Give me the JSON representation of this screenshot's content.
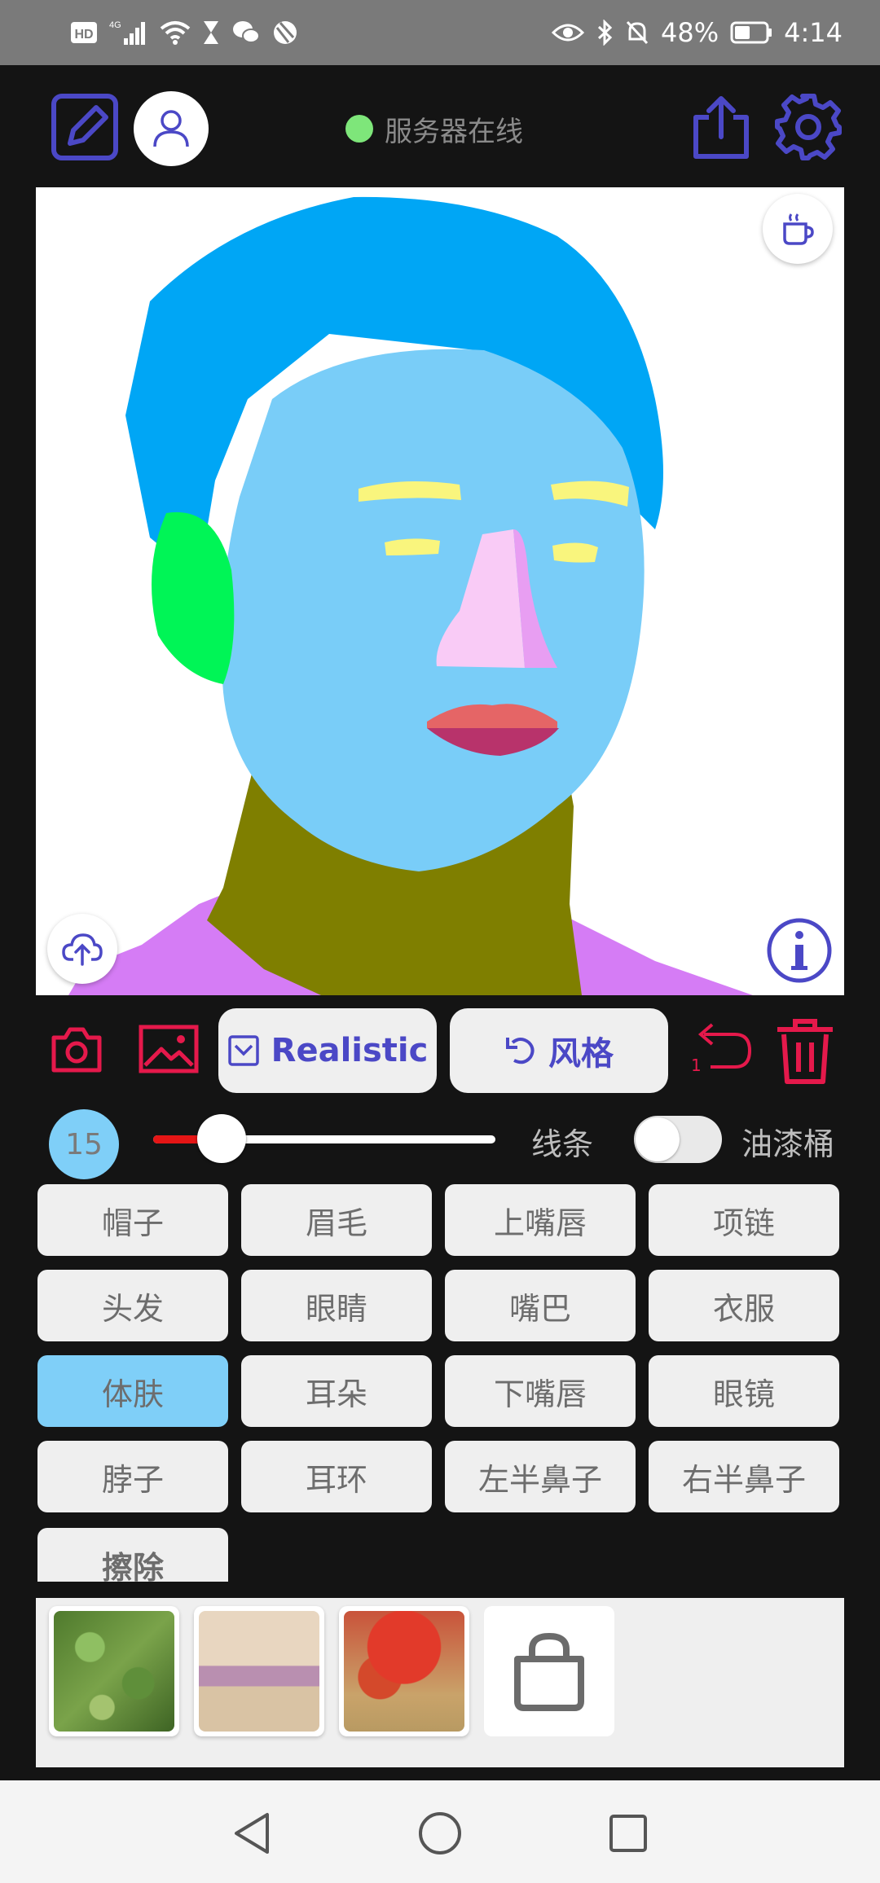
{
  "status_bar": {
    "battery": "48%",
    "time": "4:14",
    "network": "4G"
  },
  "app_bar": {
    "server_status": "服务器在线"
  },
  "toolbar": {
    "mode_label": "Realistic",
    "style_label": "风格",
    "undo_count": "1"
  },
  "brush": {
    "size": "15",
    "size_fraction": 0.2,
    "line_label": "线条",
    "bucket_label": "油漆桶",
    "bucket_enabled": false
  },
  "labels": [
    "帽子",
    "眉毛",
    "上嘴唇",
    "项链",
    "头发",
    "眼睛",
    "嘴巴",
    "衣服",
    "体肤",
    "耳朵",
    "下嘴唇",
    "眼镜",
    "脖子",
    "耳环",
    "左半鼻子",
    "右半鼻子"
  ],
  "selected_label": "体肤",
  "erase_label": "擦除",
  "colors": {
    "accent": "#4b48c6",
    "danger": "#e5194b",
    "selected": "#7fcff8",
    "server_online": "#7ee67a",
    "hair": "#00a6f5",
    "skin": "#79cdf8",
    "neck": "#7f7f00",
    "ear": "#00f556",
    "brow": "#f9f57d",
    "nose": "#f9cbf6",
    "lips": "#e56566",
    "cloth": "#d57cf5"
  },
  "style_thumbs": [
    "green-foliage",
    "pink-lavender",
    "red-flowers",
    "shop-bag-icon"
  ]
}
